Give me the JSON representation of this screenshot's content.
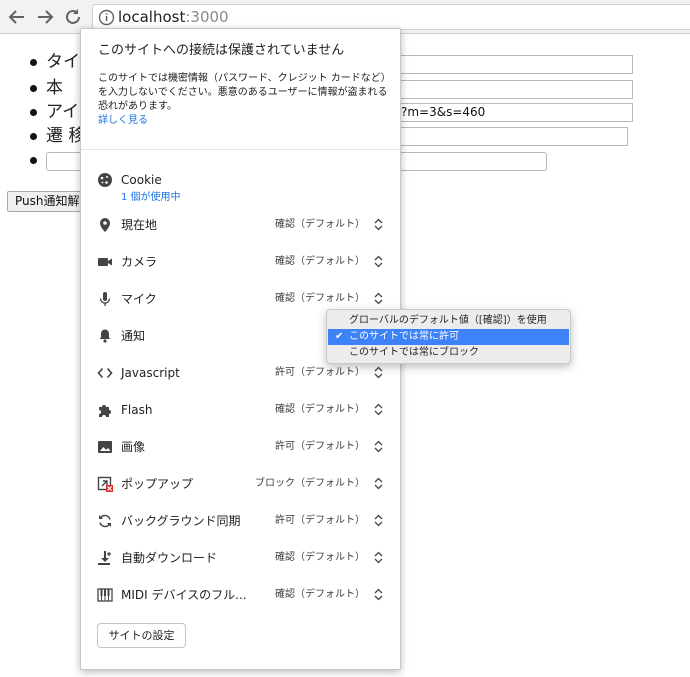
{
  "browser": {
    "url_host": "localhost",
    "url_port": ":3000"
  },
  "page": {
    "list_items": [
      "タイ",
      "本",
      "アイ",
      "遷 移",
      ""
    ],
    "inputs": [
      "",
      "",
      "?m=3&s=460",
      "",
      ""
    ],
    "push_button_label": "Push通知解除"
  },
  "popup": {
    "title": "このサイトへの接続は保護されていません",
    "description": "このサイトでは機密情報（パスワード、クレジット カードなど）を入力しないでください。悪意のあるユーザーに情報が盗まれる恐れがあります。",
    "learn_more": "詳しく見る",
    "cookie": {
      "label": "Cookie",
      "sub": "1 個が使用中",
      "icon": "cookie-icon"
    },
    "permissions": [
      {
        "label": "現在地",
        "value": "確認（デフォルト）",
        "icon": "location-pin-icon"
      },
      {
        "label": "カメラ",
        "value": "確認（デフォルト）",
        "icon": "camera-icon"
      },
      {
        "label": "マイク",
        "value": "確認（デフォルト）",
        "icon": "microphone-icon"
      },
      {
        "label": "通知",
        "value": "",
        "icon": "bell-icon"
      },
      {
        "label": "Javascript",
        "value": "許可（デフォルト）",
        "icon": "code-icon"
      },
      {
        "label": "Flash",
        "value": "確認（デフォルト）",
        "icon": "puzzle-icon"
      },
      {
        "label": "画像",
        "value": "許可（デフォルト）",
        "icon": "image-icon"
      },
      {
        "label": "ポップアップ",
        "value": "ブロック（デフォルト）",
        "icon": "popup-blocked-icon"
      },
      {
        "label": "バックグラウンド同期",
        "value": "許可（デフォルト）",
        "icon": "sync-icon"
      },
      {
        "label": "自動ダウンロード",
        "value": "確認（デフォルト）",
        "icon": "download-icon"
      },
      {
        "label": "MIDI デバイスのフル...",
        "value": "確認（デフォルト）",
        "icon": "piano-keys-icon"
      }
    ],
    "site_settings_label": "サイトの設定"
  },
  "dropdown": {
    "options": [
      "グローバルのデフォルト値（[確認]）を使用",
      "このサイトでは常に許可",
      "このサイトでは常にブロック"
    ],
    "selected_index": 1,
    "check_mark": "✔"
  },
  "colors": {
    "link": "#1a73e8",
    "selection": "#3e82f7"
  }
}
